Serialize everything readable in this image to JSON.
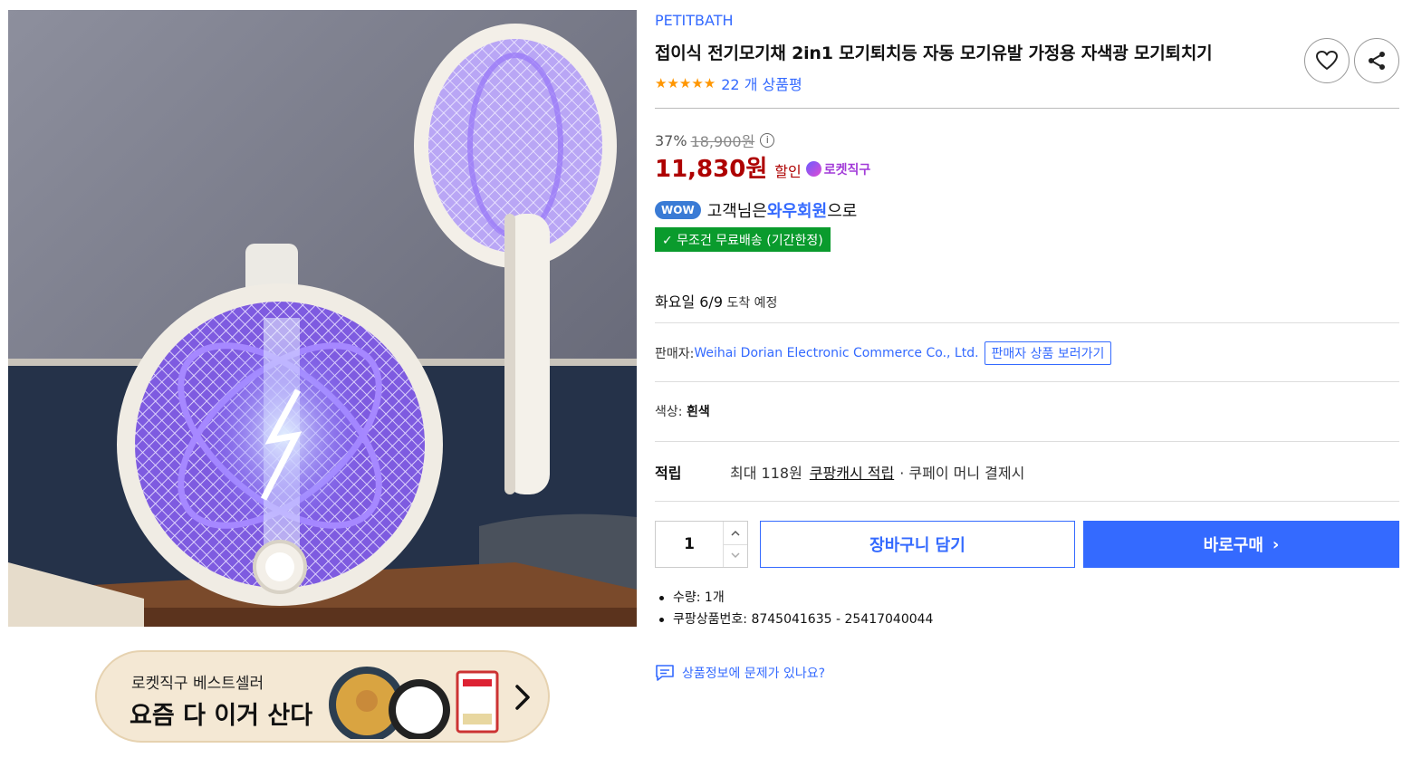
{
  "product": {
    "brand": "PETITBATH",
    "title": "접이식 전기모기채 2in1 모기퇴치등 자동 모기유발 가정용 자색광 모기퇴치기",
    "stars": "★★★★★",
    "review_count": "22 개 상품평"
  },
  "price": {
    "discount_rate": "37%",
    "original_price": "18,900원",
    "info_symbol": "i",
    "sale_price": "11,830원",
    "sale_label": "할인",
    "rocket_label": "로켓직구"
  },
  "membership": {
    "badge": "WOW",
    "text_before": "고객님은 ",
    "highlight": "와우회원",
    "text_after": "으로"
  },
  "shipping": {
    "free_label": "✓ 무조건 무료배송 (기간한정)",
    "delivery_date": "화요일 6/9",
    "delivery_suffix": " 도착 예정"
  },
  "seller": {
    "label": "판매자: ",
    "name": "Weihai Dorian Electronic Commerce Co., Ltd.",
    "link": "판매자 상품 보러가기"
  },
  "option": {
    "label": "색상: ",
    "value": "흰색"
  },
  "points": {
    "label": "적립",
    "amount": "최대 118원",
    "link": "쿠팡캐시 적립",
    "tail": "· 쿠페이 머니 결제시"
  },
  "purchase": {
    "quantity": "1",
    "cart_button": "장바구니 담기",
    "buy_button": "바로구매",
    "buy_chevron": "›"
  },
  "details": [
    "수량: 1개",
    "쿠팡상품번호: 8745041635 - 25417040044"
  ],
  "report_link": "상품정보에 문제가 있나요?",
  "banner": {
    "subtitle": "로켓직구 베스트셀러",
    "title": "요즘 다 이거 산다"
  },
  "colors": {
    "accent": "#346aff",
    "sale": "#ae0000",
    "free_ship": "#0a9b2d",
    "star": "#ff9600",
    "purple_light": "#8a5cff"
  }
}
